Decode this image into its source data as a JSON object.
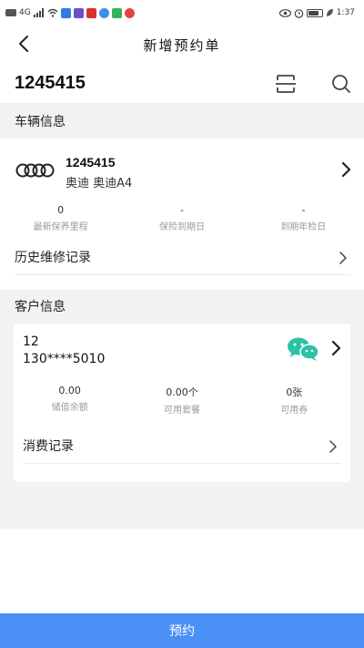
{
  "status_bar": {
    "left_icons": [
      "hd-icon",
      "signal-4g-icon",
      "wifi-icon",
      "app-icon-blue",
      "app-icon-purple",
      "app-icon-alipay",
      "app-icon-baidu",
      "app-icon-green",
      "app-icon-red"
    ],
    "network": "4G",
    "time": "1:37"
  },
  "nav": {
    "title": "新增预约单"
  },
  "search": {
    "plate": "1245415"
  },
  "vehicle_section": {
    "header": "车辆信息",
    "plate": "1245415",
    "model": "奥迪 奥迪A4",
    "stats": [
      {
        "value": "0",
        "label": "最新保养里程"
      },
      {
        "value": "-",
        "label": "保险到期日"
      },
      {
        "value": "-",
        "label": "到期年检日"
      }
    ],
    "history_label": "历史维修记录"
  },
  "customer_section": {
    "header": "客户信息",
    "name": "12",
    "phone": "130****5010",
    "stats": [
      {
        "value": "0.00",
        "label": "储值余额"
      },
      {
        "value": "0.00个",
        "label": "可用套餐"
      },
      {
        "value": "0张",
        "label": "可用券"
      }
    ],
    "consume_label": "消费记录"
  },
  "bottom": {
    "button_label": "预约"
  },
  "colors": {
    "primary": "#4a90f5",
    "wechat": "#2bc2a7",
    "section_bg": "#f2f2f2"
  }
}
